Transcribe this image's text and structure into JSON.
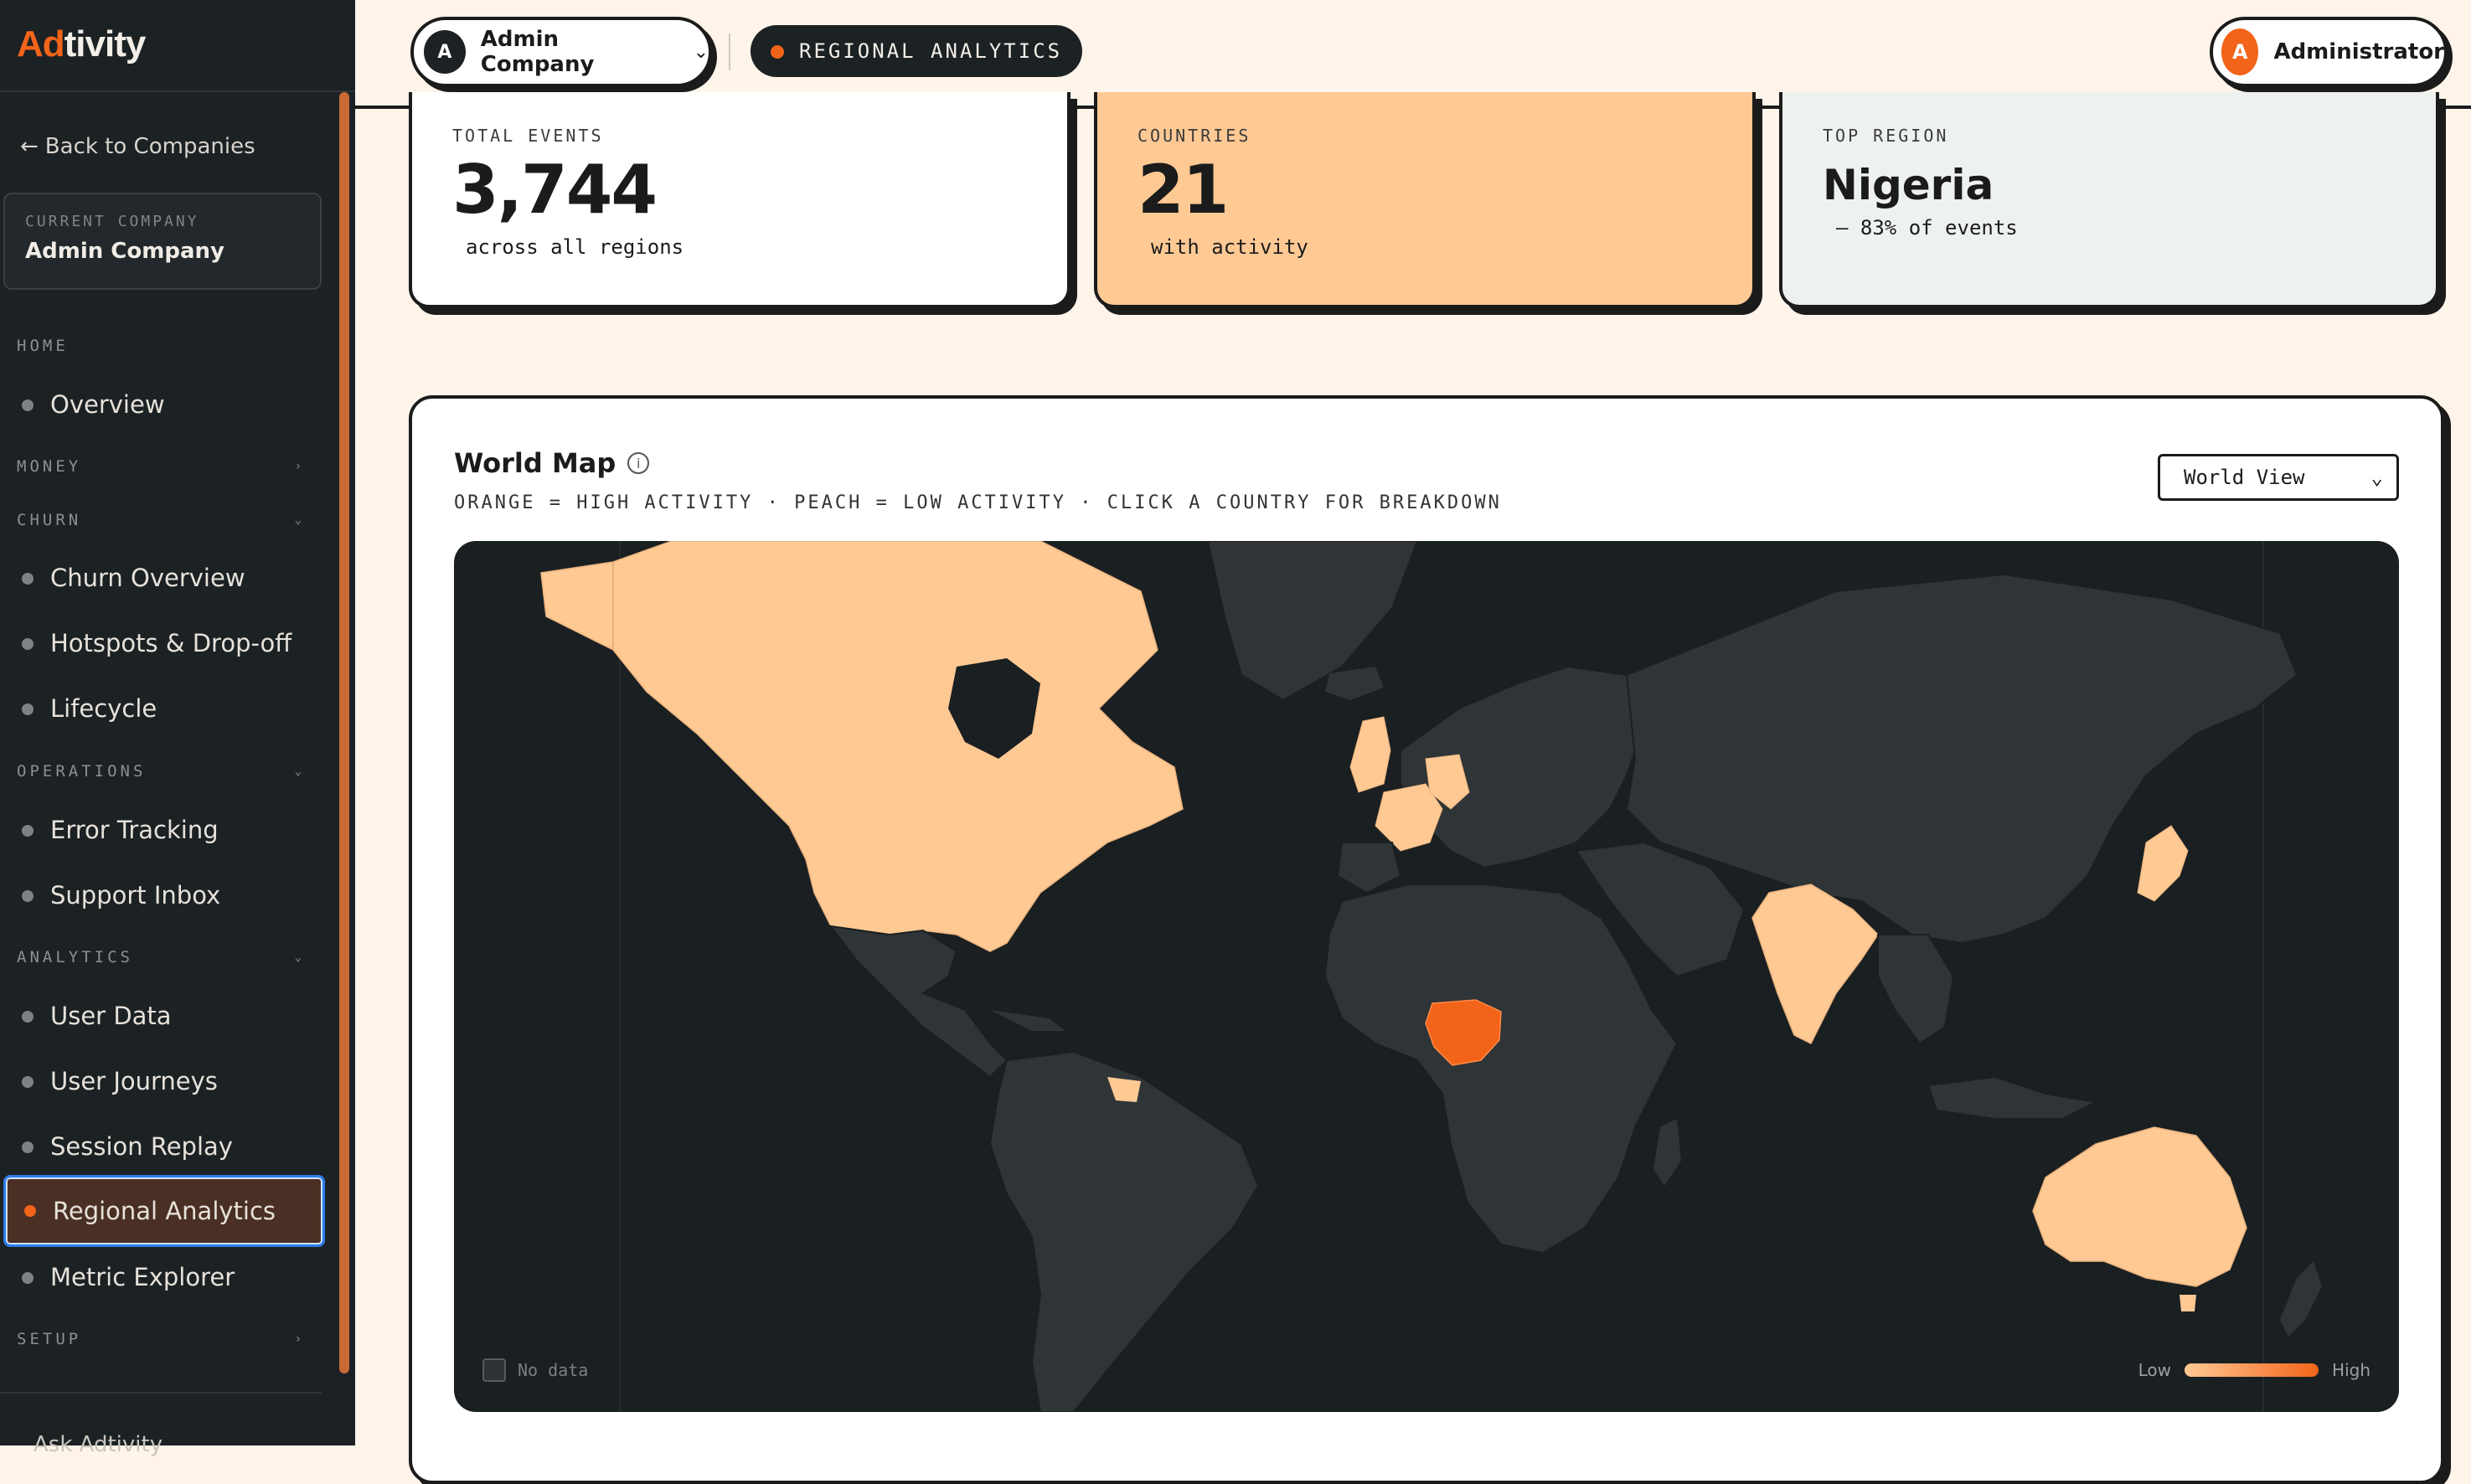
{
  "app": {
    "logo_prefix": "Ad",
    "logo_rest": "tivity"
  },
  "sidebar": {
    "back_label": "Back to Companies",
    "current_company_label": "CURRENT COMPANY",
    "current_company": "Admin Company",
    "sections": [
      {
        "label": "HOME",
        "chevron": ""
      },
      {
        "label": "MONEY",
        "chevron": "›"
      },
      {
        "label": "CHURN",
        "chevron": "⌄"
      },
      {
        "label": "OPERATIONS",
        "chevron": "⌄"
      },
      {
        "label": "ANALYTICS",
        "chevron": "⌄"
      },
      {
        "label": "SETUP",
        "chevron": "›"
      }
    ],
    "items": [
      {
        "label": "Overview"
      },
      {
        "label": "Churn Overview"
      },
      {
        "label": "Hotspots & Drop-off"
      },
      {
        "label": "Lifecycle"
      },
      {
        "label": "Error Tracking"
      },
      {
        "label": "Support Inbox"
      },
      {
        "label": "User Data"
      },
      {
        "label": "User Journeys"
      },
      {
        "label": "Session Replay"
      },
      {
        "label": "Regional Analytics",
        "active": true
      },
      {
        "label": "Metric Explorer"
      }
    ],
    "bottom_label": "Ask Adtivity"
  },
  "topbar": {
    "company_initial": "A",
    "company_name": "Admin Company",
    "page_label": "REGIONAL ANALYTICS",
    "user_initial": "A",
    "user_name": "Administrator"
  },
  "stats": [
    {
      "label": "TOTAL EVENTS",
      "value": "3,744",
      "sub": "across all regions",
      "bg": "#ffffff"
    },
    {
      "label": "COUNTRIES",
      "value": "21",
      "sub": "with activity",
      "bg": "#ffc994"
    },
    {
      "label": "TOP REGION",
      "value": "Nigeria",
      "sub": "— 83% of events",
      "bg": "#eef2ee"
    }
  ],
  "map": {
    "title": "World Map",
    "subtitle": "ORANGE = HIGH ACTIVITY · PEACH = LOW ACTIVITY · CLICK A COUNTRY FOR BREAKDOWN",
    "view_selected": "World View",
    "legend_nodata": "No data",
    "legend_low": "Low",
    "legend_high": "High",
    "colors": {
      "ocean": "#1a1f21",
      "land": "#2f3436",
      "low": "#ffc994",
      "high": "#f26419"
    }
  }
}
